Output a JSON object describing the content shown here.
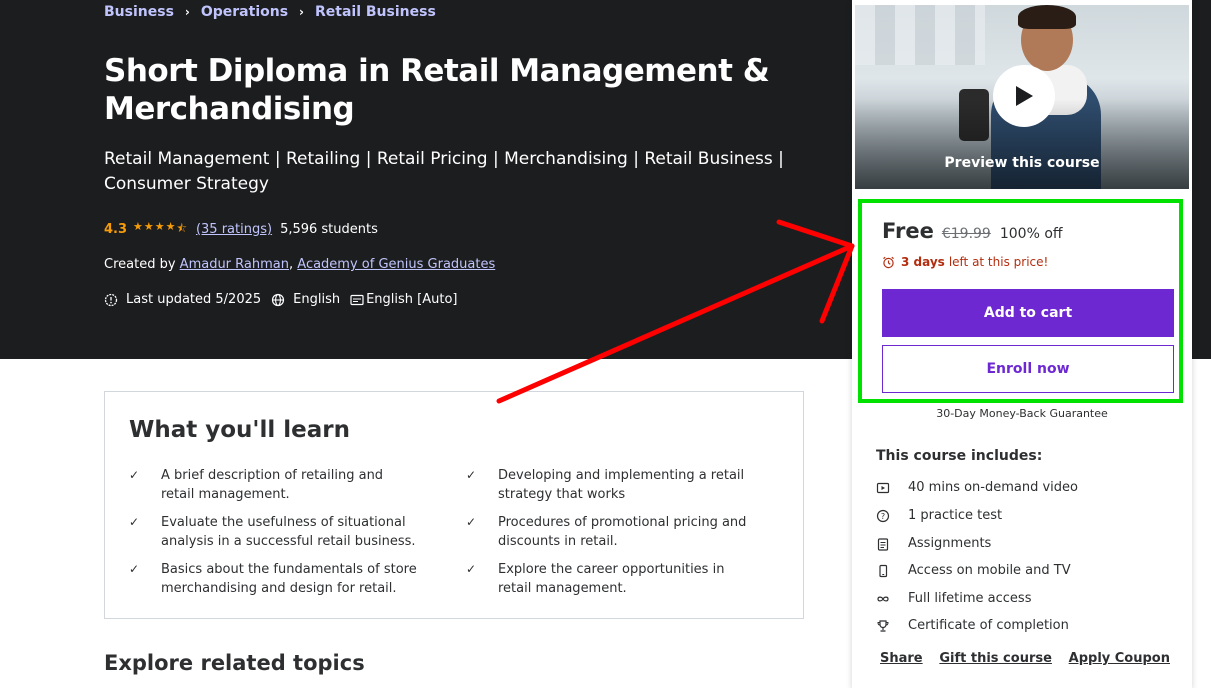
{
  "breadcrumb": [
    "Business",
    "Operations",
    "Retail Business"
  ],
  "course": {
    "title": "Short Diploma in Retail Management & Merchandising",
    "subtitle": "Retail Management | Retailing | Retail Pricing | Merchandising | Retail Business | Consumer Strategy",
    "rating": "4.3",
    "rating_stars": 4.3,
    "ratings_link": "(35 ratings)",
    "students": "5,596 students",
    "created_by_label": "Created by",
    "authors": [
      "Amadur Rahman",
      "Academy of Genius Graduates"
    ],
    "author_sep": ",",
    "last_updated": "Last updated 5/2025",
    "language": "English",
    "captions": "English [Auto]"
  },
  "learn": {
    "title": "What you'll learn",
    "items": [
      "A brief description of retailing and retail management.",
      "Developing and implementing a retail strategy that works",
      "Evaluate the usefulness of situational analysis in a successful retail business.",
      "Procedures of promotional pricing and discounts in retail.",
      "Basics about the fundamentals of store merchandising and design for retail.",
      "Explore the career opportunities in retail management."
    ]
  },
  "related_title": "Explore related topics",
  "sidebar": {
    "preview_label": "Preview this course",
    "price": "Free",
    "old_price": "€19.99",
    "discount": "100% off",
    "countdown_bold": "3 days",
    "countdown_rest": "left at this price!",
    "add_to_cart": "Add to cart",
    "enroll_now": "Enroll now",
    "guarantee": "30-Day Money-Back Guarantee",
    "includes_title": "This course includes:",
    "includes": [
      {
        "icon": "video-icon",
        "label": "40 mins on-demand video"
      },
      {
        "icon": "question-icon",
        "label": "1 practice test"
      },
      {
        "icon": "assignment-icon",
        "label": "Assignments"
      },
      {
        "icon": "mobile-icon",
        "label": "Access on mobile and TV"
      },
      {
        "icon": "infinity-icon",
        "label": "Full lifetime access"
      },
      {
        "icon": "trophy-icon",
        "label": "Certificate of completion"
      }
    ],
    "links": [
      "Share",
      "Gift this course",
      "Apply Coupon"
    ]
  },
  "colors": {
    "hero_bg": "#1c1d1f",
    "accent_purple": "#6d28d2",
    "star": "#f69c08",
    "link_light": "#c0c4fc",
    "highlight_box": "#00e100",
    "annotation_arrow": "#ff0000",
    "countdown": "#b32d0f"
  }
}
